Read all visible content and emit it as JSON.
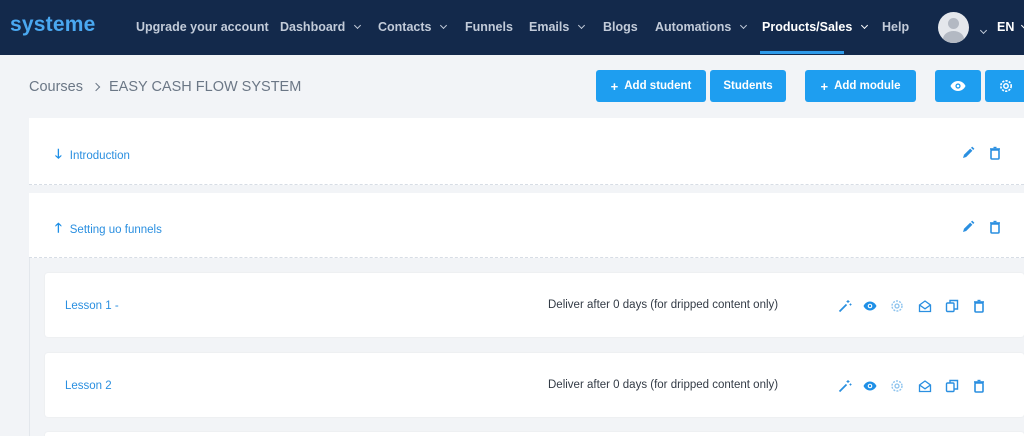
{
  "app": {
    "logo": "systeme"
  },
  "nav": {
    "items": [
      {
        "label": "Upgrade your account",
        "chevron": false
      },
      {
        "label": "Dashboard",
        "chevron": true
      },
      {
        "label": "Contacts",
        "chevron": true
      },
      {
        "label": "Funnels",
        "chevron": false
      },
      {
        "label": "Emails",
        "chevron": true
      },
      {
        "label": "Blogs",
        "chevron": false
      },
      {
        "label": "Automations",
        "chevron": true
      },
      {
        "label": "Products/Sales",
        "chevron": true,
        "active": true
      },
      {
        "label": "Help",
        "chevron": false
      }
    ],
    "language": "EN"
  },
  "breadcrumb": {
    "root": "Courses",
    "current": "EASY CASH FLOW SYSTEM"
  },
  "toolbar": {
    "add_student": "Add student",
    "students": "Students",
    "add_module": "Add module",
    "preview_icon": "eye-icon",
    "settings_icon": "settings-icon"
  },
  "modules": [
    {
      "title": "Introduction",
      "arrow": "arrow-down-icon",
      "arrow_glyph": "🡓"
    },
    {
      "title": "Setting uo funnels",
      "arrow": "arrow-up-icon",
      "arrow_glyph": "🡑"
    }
  ],
  "lessons": [
    {
      "title": "Lesson 1 -",
      "deliver": "Deliver after 0 days (for dripped content only)"
    },
    {
      "title": "Lesson 2",
      "deliver": "Deliver after 0 days (for dripped content only)"
    }
  ],
  "colors": {
    "nav_bg": "#13294b",
    "accent": "#1e9ef0",
    "link": "#2a8fe0",
    "page_bg": "#f2f4f7"
  }
}
